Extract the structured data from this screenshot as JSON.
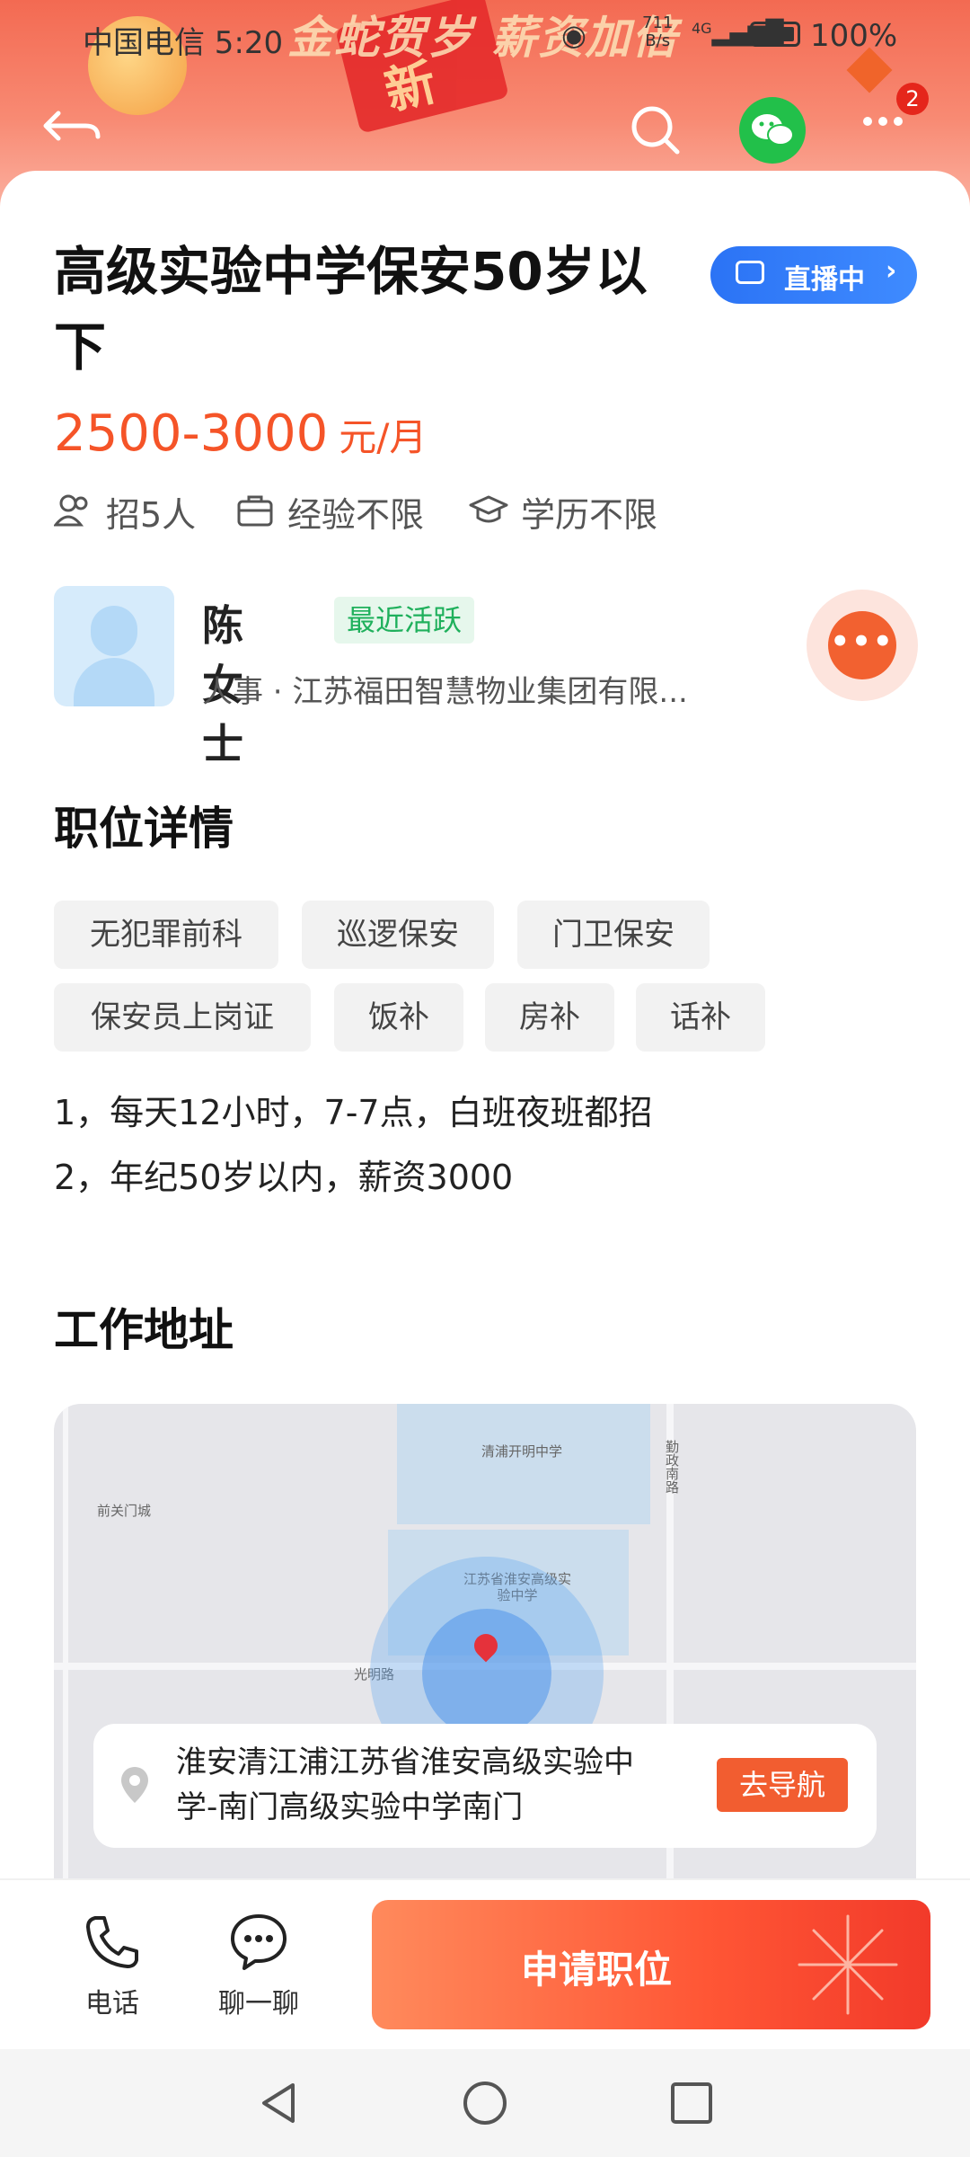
{
  "status_bar": {
    "carrier": "中国电信 5:20",
    "net_speed": "711",
    "net_unit": "B/s",
    "signal": "4G",
    "battery": "100%"
  },
  "header": {
    "notification_count": "2"
  },
  "job": {
    "title": "高级实验中学保安50岁以下",
    "live_label": "直播中",
    "salary": "2500-3000",
    "salary_unit": "元/月",
    "requirements": [
      "招5人",
      "经验不限",
      "学历不限"
    ]
  },
  "contact": {
    "name": "陈女士",
    "status": "最近活跃",
    "role": "人事 · 江苏福田智慧物业集团有限..."
  },
  "details": {
    "title": "职位详情",
    "tags": [
      "无犯罪前科",
      "巡逻保安",
      "门卫保安",
      "保安员上岗证",
      "饭补",
      "房补",
      "话补"
    ],
    "lines": [
      "1，每天12小时，7-7点，白班夜班都招",
      "2，年纪50岁以内，薪资3000"
    ]
  },
  "address": {
    "title": "工作地址",
    "map_labels": [
      "清浦开明中学",
      "勤政南路",
      "前关门城",
      "江苏省淮安高级实验中学",
      "光明路"
    ],
    "text": "淮安清江浦江苏省淮安高级实验中学-南门高级实验中学南门",
    "nav_button": "去导航"
  },
  "bottom": {
    "phone_label": "电话",
    "chat_label": "聊一聊",
    "apply_label": "申请职位"
  },
  "colors": {
    "accent": "#f55428",
    "live_blue": "#2b73f5",
    "active_green": "#1fb05c"
  }
}
